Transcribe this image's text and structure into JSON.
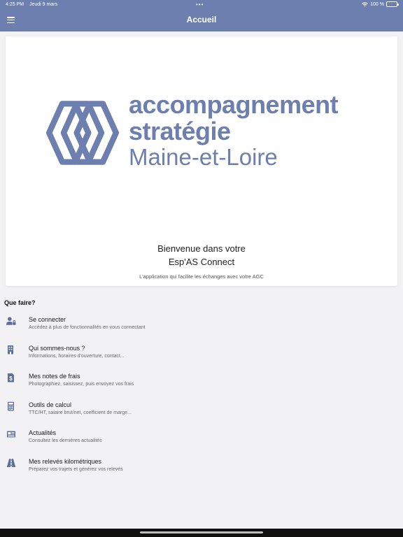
{
  "status_bar": {
    "time": "4:25 PM",
    "date": "Jeudi 9 mars",
    "battery": "100 %"
  },
  "header": {
    "title": "Accueil"
  },
  "logo": {
    "line1": "accompagnement",
    "line2": "stratégie",
    "line3": "Maine-et-Loire"
  },
  "welcome": {
    "line1": "Bienvenue dans votre",
    "line2": "Esp'AS Connect",
    "subtitle": "L'application qui facilite les échanges avec votre AGC"
  },
  "section_title": "Que faire?",
  "menu_items": [
    {
      "title": "Se connecter",
      "desc": "Accédez à plus de fonctionnalités en vous connectant",
      "icon": "user-lock-icon"
    },
    {
      "title": "Qui sommes-nous ?",
      "desc": "Informations, horaires d'ouverture, contact...",
      "icon": "building-icon"
    },
    {
      "title": "Mes notes de frais",
      "desc": "Photographiez, saisissez, puis envoyez vos frais",
      "icon": "receipt-icon"
    },
    {
      "title": "Outils de calcul",
      "desc": "TTC/HT, salaire brut/net, coefficient de marge...",
      "icon": "calculator-icon"
    },
    {
      "title": "Actualités",
      "desc": "Consultez les dernières actualités",
      "icon": "newspaper-icon"
    },
    {
      "title": "Mes relevés kilométriques",
      "desc": "Préparez vos trajets et générez vos relevés",
      "icon": "road-icon"
    }
  ],
  "colors": {
    "header": "#6c7fae",
    "icon": "#5f6f9c",
    "logo": "#6c7fae"
  }
}
